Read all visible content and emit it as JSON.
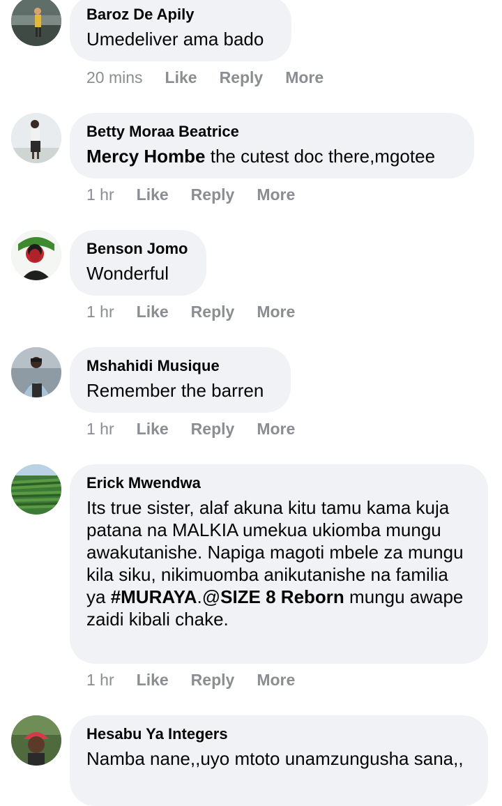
{
  "comments": [
    {
      "author": "Baroz De Apily",
      "text": "Umedeliver ama bado",
      "time": "20 mins",
      "actions": [
        "Like",
        "Reply",
        "More"
      ]
    },
    {
      "author": "Betty Moraa Beatrice",
      "mention": "Mercy Hombe",
      "text": " the cutest doc there,mgotee",
      "time": "1 hr",
      "actions": [
        "Like",
        "Reply",
        "More"
      ]
    },
    {
      "author": "Benson Jomo",
      "text": "Wonderful",
      "time": "1 hr",
      "actions": [
        "Like",
        "Reply",
        "More"
      ]
    },
    {
      "author": "Mshahidi Musique",
      "text": "Remember the barren",
      "time": "1 hr",
      "actions": [
        "Like",
        "Reply",
        "More"
      ]
    },
    {
      "author": "Erick Mwendwa",
      "text_part1": "Its true sister, alaf akuna kitu tamu kama kuja patana na MALKIA umekua ukiomba mungu awakutanishe. Napiga magoti mbele za mungu kila siku, nikimuomba anikutanishe na familia ya ",
      "hashtag": "#MURAYA",
      "text_part2": ".@",
      "mention": "SIZE 8 Reborn",
      "text_part3": " mungu awape zaidi kibali chake.",
      "time": "1 hr",
      "actions": [
        "Like",
        "Reply",
        "More"
      ]
    },
    {
      "author": "Hesabu Ya Integers",
      "text": "Namba nane,,uyo mtoto unamzungusha sana,,"
    }
  ]
}
